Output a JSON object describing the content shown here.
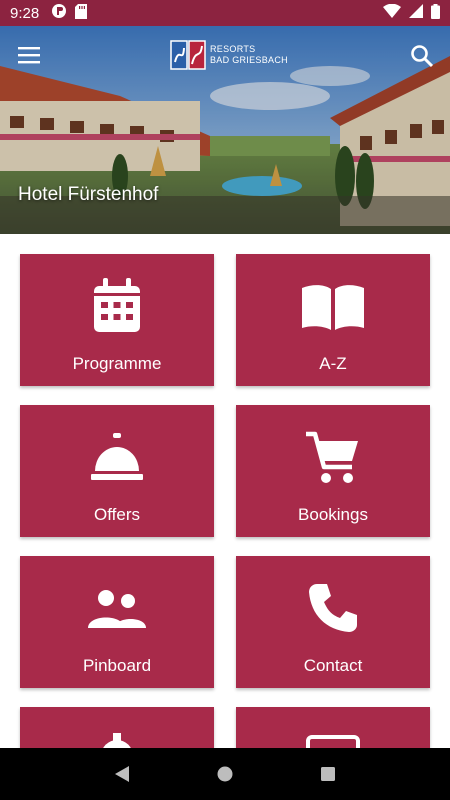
{
  "status_bar": {
    "time": "9:28"
  },
  "header": {
    "logo_line1": "RESORTS",
    "logo_line2": "BAD GRIESBACH",
    "title": "Hotel Fürstenhof"
  },
  "tiles": [
    {
      "label": "Programme",
      "icon": "calendar-icon"
    },
    {
      "label": "A-Z",
      "icon": "book-icon"
    },
    {
      "label": "Offers",
      "icon": "service-bell-icon"
    },
    {
      "label": "Bookings",
      "icon": "cart-icon"
    },
    {
      "label": "Pinboard",
      "icon": "people-icon"
    },
    {
      "label": "Contact",
      "icon": "phone-icon"
    },
    {
      "label": "",
      "icon": "gear-icon"
    },
    {
      "label": "",
      "icon": "monitor-icon"
    }
  ],
  "colors": {
    "status_bar": "#8c2340",
    "tile": "#a82a4a",
    "nav_bar": "#000000"
  }
}
